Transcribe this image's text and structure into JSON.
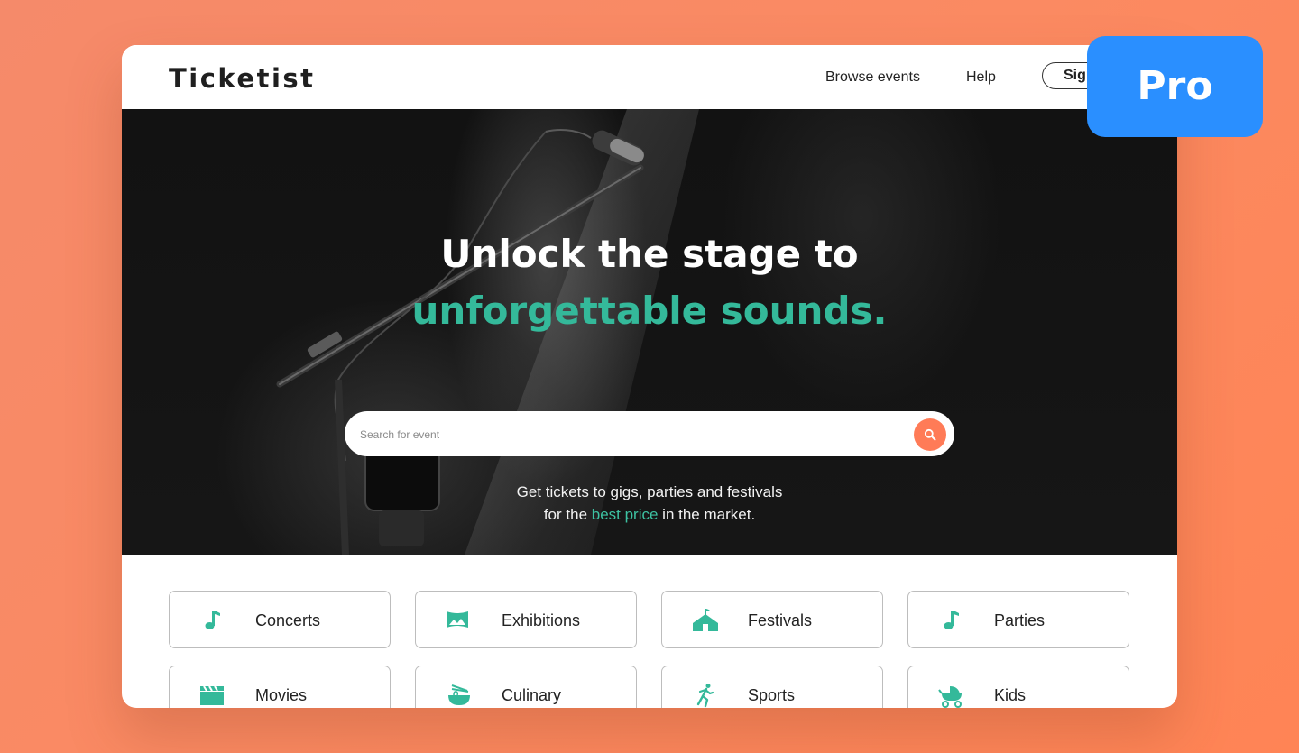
{
  "brand": {
    "logo": "Ticketist"
  },
  "nav": {
    "browse_events": "Browse events",
    "help": "Help",
    "sign_in": "Sign in"
  },
  "hero": {
    "title_line1": "Unlock the stage to",
    "title_line2": "unforgettable sounds.",
    "search": {
      "placeholder": "Search for event",
      "value": ""
    },
    "subtitle_line1": "Get tickets to gigs, parties and festivals",
    "subtitle_line2_before": "for the ",
    "subtitle_line2_highlight": "best price",
    "subtitle_line2_after": " in the market."
  },
  "categories": [
    {
      "label": "Concerts",
      "icon": "music-note-icon"
    },
    {
      "label": "Exhibitions",
      "icon": "picture-icon"
    },
    {
      "label": "Festivals",
      "icon": "tent-icon"
    },
    {
      "label": "Parties",
      "icon": "music-note-icon"
    },
    {
      "label": "Movies",
      "icon": "clapperboard-icon"
    },
    {
      "label": "Culinary",
      "icon": "noodle-bowl-icon"
    },
    {
      "label": "Sports",
      "icon": "running-person-icon"
    },
    {
      "label": "Kids",
      "icon": "stroller-icon"
    }
  ],
  "badge": {
    "label": "Pro"
  },
  "colors": {
    "accent": "#34b99a",
    "search_button": "#ff7b57",
    "badge": "#2a8fff",
    "background": "#fb8a62"
  }
}
